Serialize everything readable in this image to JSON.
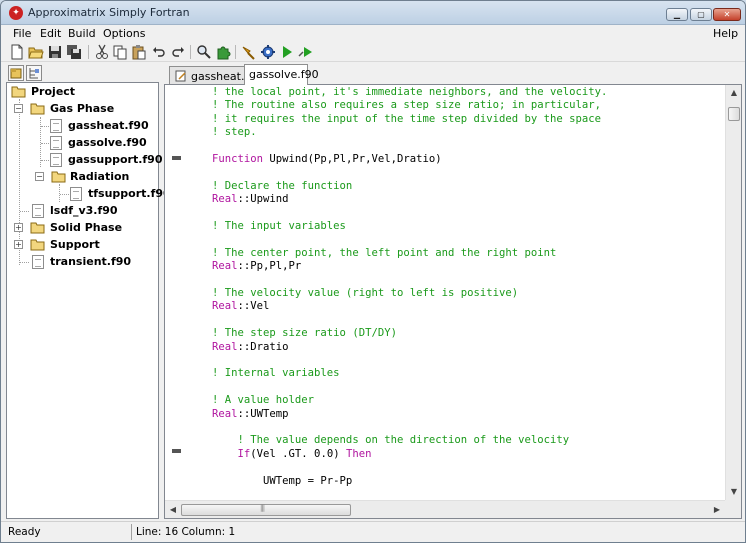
{
  "window": {
    "title": "Approximatrix Simply Fortran",
    "minimize_glyph": "▁",
    "maximize_glyph": "▢",
    "close_glyph": "✕"
  },
  "menu": {
    "items": [
      {
        "label": "File"
      },
      {
        "label": "Edit"
      },
      {
        "label": "Build"
      },
      {
        "label": "Options"
      }
    ],
    "help": "Help"
  },
  "toolbar": {
    "icons": [
      "new-file-icon",
      "open-folder-icon",
      "save-icon",
      "save-all-icon",
      "cut-icon",
      "copy-icon",
      "paste-icon",
      "undo-icon",
      "redo-icon",
      "search-icon",
      "puzzle-icon",
      "build-icon",
      "settings-gear-icon",
      "run-icon",
      "debug-run-icon"
    ]
  },
  "sidebar": {
    "tabs": [
      "project-tab-icon",
      "outline-tab-icon"
    ],
    "tree": [
      {
        "label": "Project",
        "type": "root-folder"
      },
      {
        "label": "Gas Phase",
        "type": "folder",
        "expanded": true
      },
      {
        "label": "gassheat.f90",
        "type": "file"
      },
      {
        "label": "gassolve.f90",
        "type": "file"
      },
      {
        "label": "gassupport.f90",
        "type": "file"
      },
      {
        "label": "Radiation",
        "type": "folder",
        "expanded": true
      },
      {
        "label": "tfsupport.f90",
        "type": "file"
      },
      {
        "label": "lsdf_v3.f90",
        "type": "file"
      },
      {
        "label": "Solid Phase",
        "type": "folder",
        "expanded": false
      },
      {
        "label": "Support",
        "type": "folder",
        "expanded": false
      },
      {
        "label": "transient.f90",
        "type": "file"
      }
    ]
  },
  "tabs": [
    {
      "label": "gassheat.f90",
      "active": false
    },
    {
      "label": "gassolve.f90",
      "active": true
    }
  ],
  "code": {
    "lines": [
      [
        {
          "t": "! the local point, it's immediate neighbors, and the velocity.",
          "c": "green"
        }
      ],
      [
        {
          "t": "! The routine also requires a step size ratio; in particular,",
          "c": "green"
        }
      ],
      [
        {
          "t": "! it requires the input of the time step divided by the space",
          "c": "green"
        }
      ],
      [
        {
          "t": "! step.",
          "c": "green"
        }
      ],
      [],
      [
        {
          "t": "Function",
          "c": "magenta"
        },
        {
          "t": " Upwind(Pp,Pl,Pr,Vel,Dratio)",
          "c": "black"
        }
      ],
      [],
      [
        {
          "t": "! Declare the function",
          "c": "green"
        }
      ],
      [
        {
          "t": "Real",
          "c": "magenta"
        },
        {
          "t": "::Upwind",
          "c": "black"
        }
      ],
      [],
      [
        {
          "t": "! The input variables",
          "c": "green"
        }
      ],
      [],
      [
        {
          "t": "! The center point, the left point and the right point",
          "c": "green"
        }
      ],
      [
        {
          "t": "Real",
          "c": "magenta"
        },
        {
          "t": "::Pp,Pl,Pr",
          "c": "black"
        }
      ],
      [],
      [
        {
          "t": "! The velocity value (right to left is positive)",
          "c": "green"
        }
      ],
      [
        {
          "t": "Real",
          "c": "magenta"
        },
        {
          "t": "::Vel",
          "c": "black"
        }
      ],
      [],
      [
        {
          "t": "! The step size ratio (DT/DY)",
          "c": "green"
        }
      ],
      [
        {
          "t": "Real",
          "c": "magenta"
        },
        {
          "t": "::Dratio",
          "c": "black"
        }
      ],
      [],
      [
        {
          "t": "! Internal variables",
          "c": "green"
        }
      ],
      [],
      [
        {
          "t": "! A value holder",
          "c": "green"
        }
      ],
      [
        {
          "t": "Real",
          "c": "magenta"
        },
        {
          "t": "::UWTemp",
          "c": "black"
        }
      ],
      [],
      [
        {
          "t": "    ! The value depends on the direction of the velocity",
          "c": "green"
        }
      ],
      [
        {
          "t": "    ",
          "c": "black"
        },
        {
          "t": "If",
          "c": "magenta"
        },
        {
          "t": "(Vel .GT. 0.0) ",
          "c": "black"
        },
        {
          "t": "Then",
          "c": "magenta"
        }
      ],
      [],
      [
        {
          "t": "        UWTemp = Pr-Pp",
          "c": "black"
        }
      ]
    ]
  },
  "scrollbars": {
    "up": "▲",
    "down": "▼",
    "left": "◀",
    "right": "▶"
  },
  "status": {
    "state": "Ready",
    "position": "Line: 16 Column: 1"
  },
  "colors": {
    "comment": "#1b9a1b",
    "keyword": "#b0159f",
    "text": "#000000"
  }
}
